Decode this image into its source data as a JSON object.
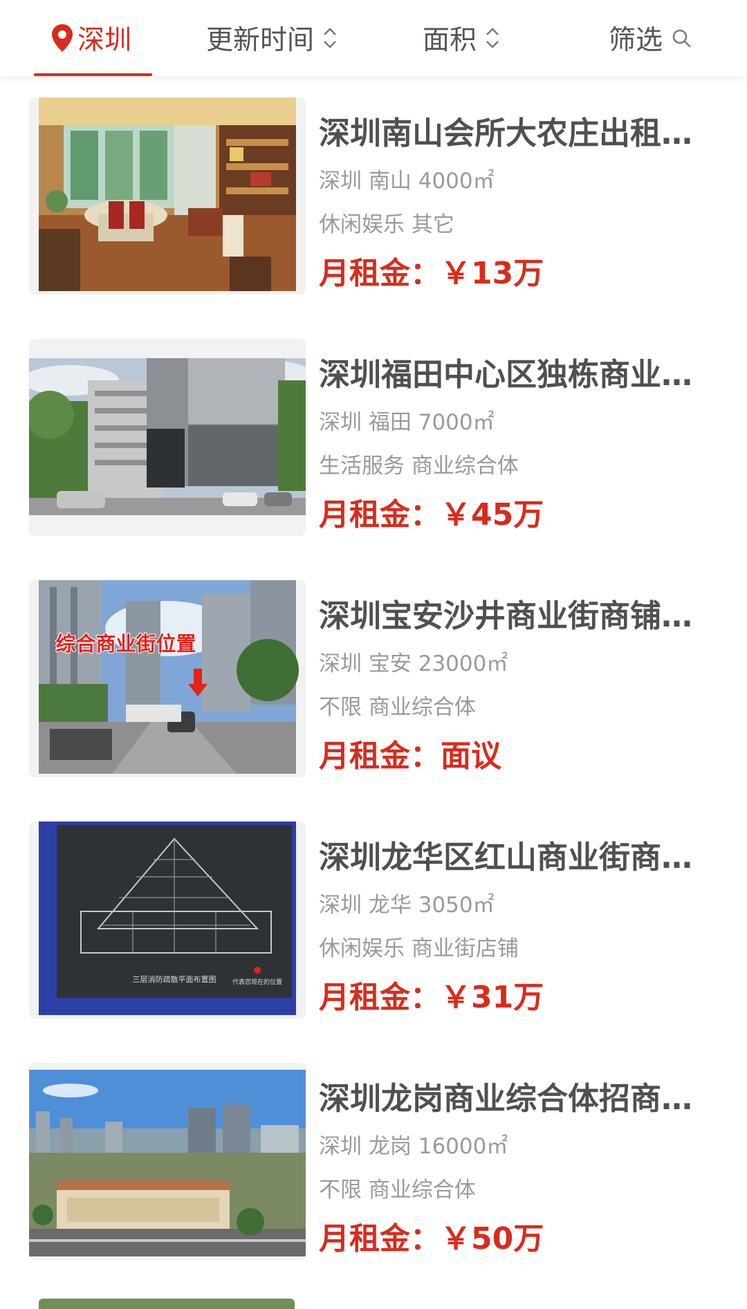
{
  "filter_bar": {
    "city": "深圳",
    "sort_time": "更新时间",
    "sort_area": "面积",
    "filter": "筛选"
  },
  "listings": [
    {
      "title": "深圳南山会所大农庄出租整栋独立会所",
      "city": "深圳",
      "district": "南山",
      "area": "4000㎡",
      "category": "休闲娱乐",
      "type": "其它",
      "price_label": "月租金：",
      "price_value": "￥13万"
    },
    {
      "title": "深圳福田中心区独栋商业楼整栋出租",
      "city": "深圳",
      "district": "福田",
      "area": "7000㎡",
      "category": "生活服务",
      "type": "商业综合体",
      "price_label": "月租金：",
      "price_value": "￥45万"
    },
    {
      "title": "深圳宝安沙井商业街商铺整体招商",
      "city": "深圳",
      "district": "宝安",
      "area": "23000㎡",
      "category": "不限",
      "type": "商业综合体",
      "price_label": "月租金：",
      "price_value": "面议",
      "image_caption": "综合商业街位置"
    },
    {
      "title": "深圳龙华区红山商业街商铺出租",
      "city": "深圳",
      "district": "龙华",
      "area": "3050㎡",
      "category": "休闲娱乐",
      "type": "商业街店铺",
      "price_label": "月租金：",
      "price_value": "￥31万",
      "image_caption": "三层消防疏散平面布置图",
      "image_note": "代表您现在的位置"
    },
    {
      "title": "深圳龙岗商业综合体招商整体出租",
      "city": "深圳",
      "district": "龙岗",
      "area": "16000㎡",
      "category": "不限",
      "type": "商业综合体",
      "price_label": "月租金：",
      "price_value": "￥50万"
    }
  ],
  "colors": {
    "accent": "#d92b1c",
    "title_text": "#505050",
    "meta_text": "#9a9a9a"
  },
  "icons": [
    "location-pin-icon",
    "sort-arrows-icon",
    "search-icon"
  ]
}
